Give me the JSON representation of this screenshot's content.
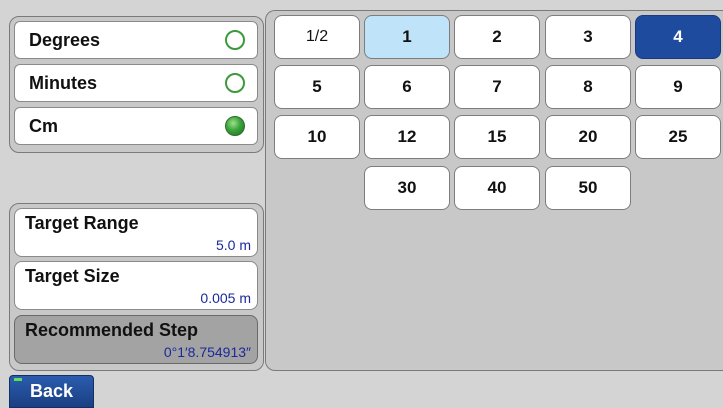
{
  "units": [
    {
      "label": "Degrees",
      "selected": false
    },
    {
      "label": "Minutes",
      "selected": false
    },
    {
      "label": "Cm",
      "selected": true
    }
  ],
  "info": {
    "target_range": {
      "label": "Target Range",
      "value": "5.0 m"
    },
    "target_size": {
      "label": "Target Size",
      "value": "0.005 m"
    },
    "recommended_step": {
      "label": "Recommended Step",
      "value": "0°1′8.754913″"
    }
  },
  "grid": {
    "row1": [
      "1/2",
      "1",
      "2",
      "3",
      "4"
    ],
    "row2": [
      "5",
      "6",
      "7",
      "8",
      "9"
    ],
    "row3": [
      "10",
      "12",
      "15",
      "20",
      "25"
    ],
    "row4": [
      "30",
      "40",
      "50"
    ],
    "highlighted": "1",
    "selected": "4"
  },
  "footer": {
    "back_label": "Back"
  },
  "colors": {
    "selected": "#1f4b9e",
    "highlighted": "#bfe3f8",
    "radio_on": "#3aa43a"
  }
}
